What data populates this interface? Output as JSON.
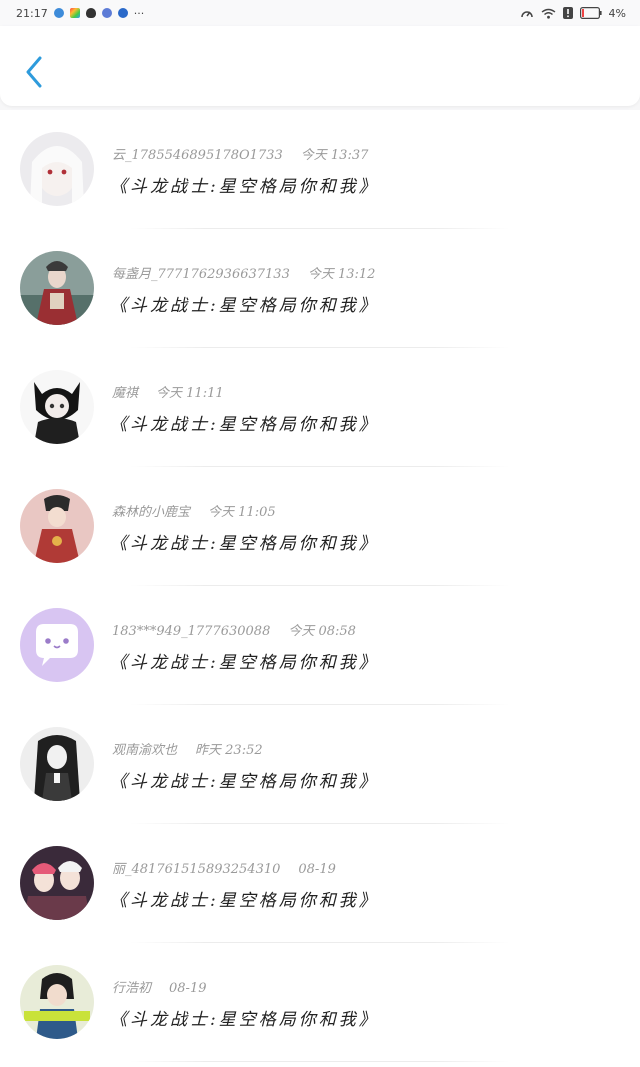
{
  "status_bar": {
    "time": "21:17",
    "more": "···",
    "battery_label": "4%"
  },
  "header": {
    "back_icon": "chevron-left-icon"
  },
  "colors": {
    "accent": "#2e9bdc",
    "purple_avatar": "#d8c5f2"
  },
  "comments": [
    {
      "user": "云_1785546895178O1733",
      "time": "今天 13:37",
      "message": "《斗龙战士:星空格局你和我》"
    },
    {
      "user": "每盏月_7771762936637133",
      "time": "今天 13:12",
      "message": "《斗龙战士:星空格局你和我》"
    },
    {
      "user": "魔祺",
      "time": "今天 11:11",
      "message": "《斗龙战士:星空格局你和我》"
    },
    {
      "user": "森林的小鹿宝",
      "time": "今天 11:05",
      "message": "《斗龙战士:星空格局你和我》"
    },
    {
      "user": "183***949_1777630088",
      "time": "今天 08:58",
      "message": "《斗龙战士:星空格局你和我》"
    },
    {
      "user": "观南渝欢也",
      "time": "昨天 23:52",
      "message": "《斗龙战士:星空格局你和我》"
    },
    {
      "user": "丽_481761515893254310",
      "time": "08-19",
      "message": "《斗龙战士:星空格局你和我》"
    },
    {
      "user": "行浩初",
      "time": "08-19",
      "message": "《斗龙战士:星空格局你和我》"
    }
  ]
}
